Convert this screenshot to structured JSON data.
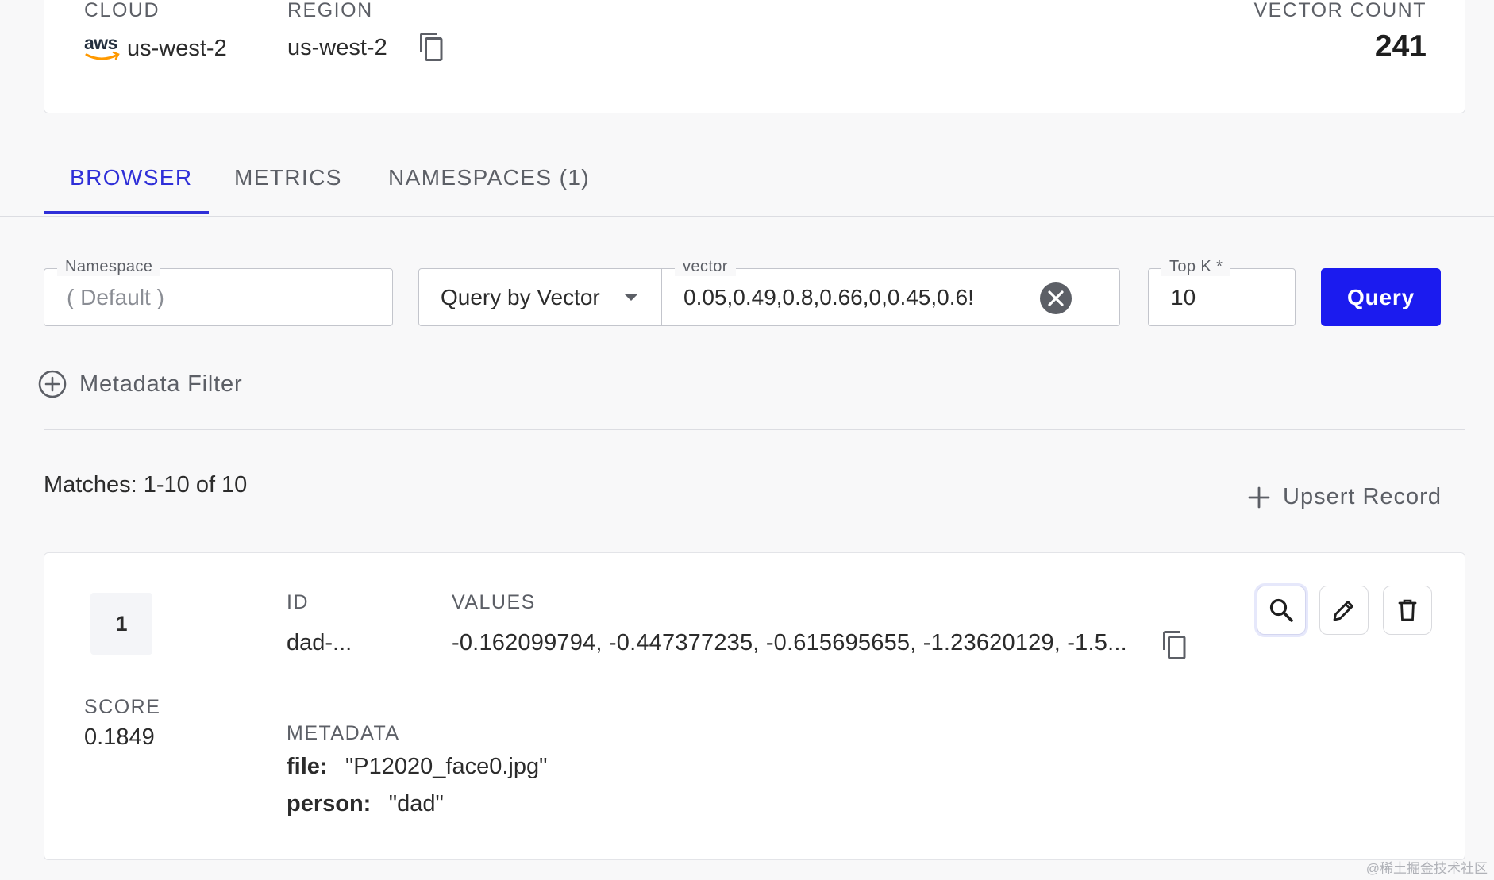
{
  "index_info": {
    "cloud_label": "CLOUD",
    "cloud_provider": "aws",
    "cloud_value": "us-west-2",
    "region_label": "REGION",
    "region_value": "us-west-2",
    "vector_count_label": "VECTOR COUNT",
    "vector_count_value": "241"
  },
  "tabs": [
    {
      "label": "BROWSER",
      "active": true
    },
    {
      "label": "METRICS",
      "active": false
    },
    {
      "label": "NAMESPACES (1)",
      "active": false
    }
  ],
  "query_bar": {
    "namespace_label": "Namespace",
    "namespace_placeholder": "( Default )",
    "query_mode": "Query by Vector",
    "vector_label": "vector",
    "vector_value": "0.05,0.49,0.8,0.66,0,0.45,0.6!",
    "topk_label": "Top K *",
    "topk_value": "10",
    "query_button": "Query"
  },
  "metadata_filter_label": "Metadata Filter",
  "matches_text": "Matches: 1-10 of 10",
  "upsert_label": "Upsert Record",
  "result": {
    "rank": "1",
    "score_label": "SCORE",
    "score_value": "0.1849",
    "id_label": "ID",
    "id_value": "dad-...",
    "values_label": "VALUES",
    "values_value": "-0.162099794, -0.447377235, -0.615695655, -1.23620129, -1.5...",
    "metadata_label": "METADATA",
    "metadata": [
      {
        "key": "file:",
        "value": "\"P12020_face0.jpg\""
      },
      {
        "key": "person:",
        "value": "\"dad\""
      }
    ]
  },
  "watermark": "@稀土掘金技术社区",
  "colors": {
    "accent": "#2f2fd8",
    "query_button": "#1b1bef",
    "aws_smile": "#ff9900"
  }
}
